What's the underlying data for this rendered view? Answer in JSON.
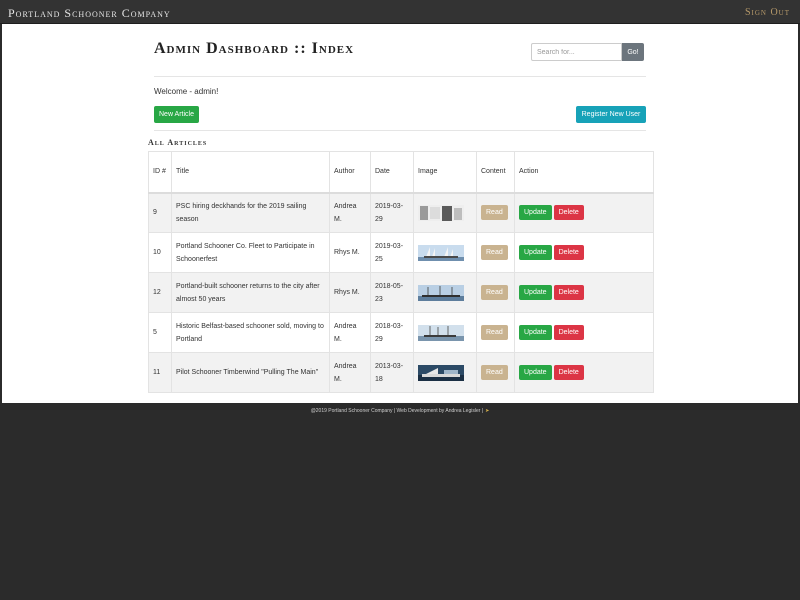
{
  "navbar": {
    "brand": "Portland Schooner Company",
    "signout_label": "Sign Out"
  },
  "header": {
    "title": "Admin Dashboard :: Index",
    "search": {
      "placeholder": "Search for...",
      "value": "",
      "button_label": "Go!"
    }
  },
  "welcome": "Welcome - admin!",
  "buttons": {
    "new_article": "New Article",
    "register_user": "Register New User"
  },
  "articles": {
    "section_title": "All Articles",
    "columns": {
      "id": "ID #",
      "title": "Title",
      "author": "Author",
      "date": "Date",
      "image": "Image",
      "content": "Content",
      "action": "Action"
    },
    "read_label": "Read",
    "update_label": "Update",
    "delete_label": "Delete",
    "rows": [
      {
        "id": "9",
        "title": "PSC hiring deckhands for the 2019 sailing season",
        "author": "Andrea M.",
        "date": "2019-03-29",
        "thumb_icon": "photo-thumbnail-crew"
      },
      {
        "id": "10",
        "title": "Portland Schooner Co. Fleet to Participate in Schoonerfest",
        "author": "Rhys M.",
        "date": "2019-03-25",
        "thumb_icon": "photo-thumbnail-schooner"
      },
      {
        "id": "12",
        "title": "Portland-built schooner returns to the city after almost 50 years",
        "author": "Rhys M.",
        "date": "2018-05-23",
        "thumb_icon": "photo-thumbnail-schooner"
      },
      {
        "id": "5",
        "title": "Historic Belfast-based schooner sold, moving to Portland",
        "author": "Andrea M.",
        "date": "2018-03-29",
        "thumb_icon": "photo-thumbnail-schooner"
      },
      {
        "id": "11",
        "title": "Pilot Schooner Timberwind \"Pulling The Main\"",
        "author": "Andrea M.",
        "date": "2013-03-18",
        "thumb_icon": "photo-thumbnail-sailing"
      }
    ]
  },
  "footer": {
    "text": "@2019 Portland Schooner Company | Web Development by Andrea Legisler |",
    "icon": "sign-in-icon"
  },
  "colors": {
    "navbar_bg": "#333333",
    "brand_text": "#e6e6e6",
    "signout_text": "#b79a6a",
    "success": "#28a745",
    "info": "#17a2b8",
    "danger": "#dc3545",
    "read_tan": "#c9b390",
    "secondary": "#6c757d"
  }
}
